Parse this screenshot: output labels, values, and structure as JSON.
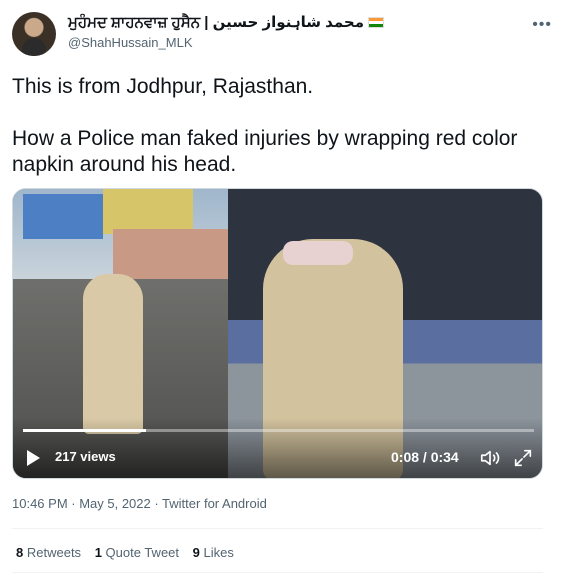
{
  "user": {
    "display_name": "ਮੁਹੰਮਦ ਸ਼ਾਹਨਵਾਜ਼ ਹੁਸੈਨ | محمد شاہنواز حسین",
    "flag_icon": "india-flag-icon",
    "handle": "@ShahHussain_MLK"
  },
  "more_icon": "more-options-icon",
  "tweet": {
    "line1": "This is from Jodhpur, Rajasthan.",
    "line2": "How a Police man faked injuries by wrapping red color napkin around his head."
  },
  "video": {
    "views": "217 views",
    "time": "0:08 / 0:34",
    "progress": 0.24,
    "play_icon": "play-icon",
    "volume_icon": "volume-icon",
    "fullscreen_icon": "fullscreen-icon"
  },
  "meta": "10:46 PM · May 5, 2022 · Twitter for Android",
  "stats": {
    "retweets_count": "8",
    "retweets_label": "Retweets",
    "quotes_count": "1",
    "quotes_label": "Quote Tweet",
    "likes_count": "9",
    "likes_label": "Likes"
  }
}
